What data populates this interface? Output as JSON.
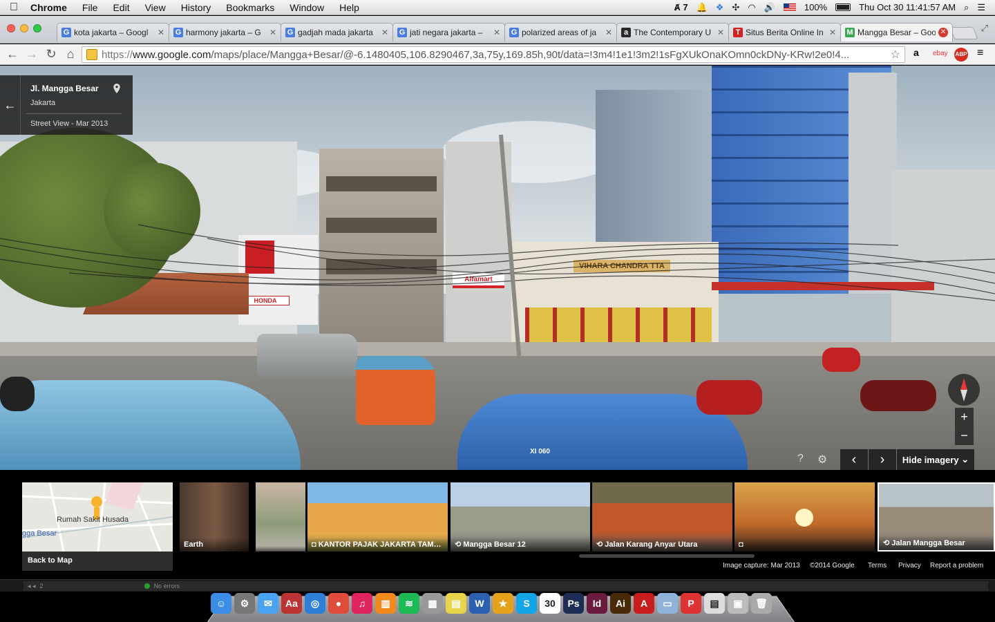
{
  "menubar": {
    "app": "Chrome",
    "items": [
      "File",
      "Edit",
      "View",
      "History",
      "Bookmarks",
      "Window",
      "Help"
    ],
    "adobe_badge": "7",
    "battery": "100%",
    "datetime": "Thu Oct 30  11:41:57 AM"
  },
  "tabs": [
    {
      "title": "kota jakarta – Googl",
      "favicon": "G",
      "color": "#4a7de2"
    },
    {
      "title": "harmony jakarta – G",
      "favicon": "G",
      "color": "#4a7de2"
    },
    {
      "title": "gadjah mada jakarta",
      "favicon": "G",
      "color": "#4a7de2"
    },
    {
      "title": "jati negara jakarta –",
      "favicon": "G",
      "color": "#4a7de2"
    },
    {
      "title": "polarized areas of ja",
      "favicon": "G",
      "color": "#4a7de2"
    },
    {
      "title": "The Contemporary U",
      "favicon": "a",
      "color": "#2a2a2a"
    },
    {
      "title": "Situs Berita Online In",
      "favicon": "T",
      "color": "#d42020"
    },
    {
      "title": "Mangga Besar – Goo",
      "favicon": "M",
      "color": "#3aa757"
    }
  ],
  "toolbar": {
    "url_prefix": "https://",
    "url_host": "www.google.com",
    "url_path": "/maps/place/Mangga+Besar/@-6.1480405,106.8290467,3a,75y,169.85h,90t/data=!3m4!1e1!3m2!1sFgXUkOnaKOmn0ckDNy-KRw!2e0!4..."
  },
  "info_card": {
    "place": "Jl. Mangga Besar",
    "city": "Jakarta",
    "date": "Street View - Mar 2013"
  },
  "controls": {
    "hide_imagery": "Hide imagery",
    "zoom_in": "+",
    "zoom_out": "−",
    "help": "?",
    "settings": "⚙",
    "prev": "‹",
    "next": "›"
  },
  "scene_signs": {
    "vihara": "VIHARA CHANDRA TTA",
    "honda": "HONDA",
    "alfamart": "Alfamart",
    "taxi_plate": "XI 060"
  },
  "filmstrip": {
    "map_label_1": "Rumah Sakit Husada",
    "map_label_2": "gga Besar",
    "back_to_map": "Back to Map",
    "thumbs": [
      {
        "caption": "Earth"
      },
      {
        "caption": ""
      },
      {
        "caption": "KANTOR PAJAK JAKARTA TAM…"
      },
      {
        "caption": "Mangga Besar 12"
      },
      {
        "caption": "Jalan Karang Anyar Utara"
      },
      {
        "caption": ""
      },
      {
        "caption": "Jalan Mangga Besar"
      }
    ],
    "footer": {
      "capture": "Image capture: Mar 2013",
      "copyright": "©2014 Google",
      "terms": "Terms",
      "privacy": "Privacy",
      "report": "Report a problem"
    }
  },
  "devbar": {
    "page": "2",
    "status": "No errors"
  },
  "dock": {
    "icons": [
      {
        "name": "finder",
        "glyph": "☺",
        "color": "#3a8ee6"
      },
      {
        "name": "system-prefs",
        "glyph": "⚙",
        "color": "#777"
      },
      {
        "name": "messages",
        "glyph": "✉",
        "color": "#4aa3f0"
      },
      {
        "name": "dictionary",
        "glyph": "Aa",
        "color": "#b33"
      },
      {
        "name": "safari",
        "glyph": "◎",
        "color": "#2d7fd8"
      },
      {
        "name": "chrome",
        "glyph": "●",
        "color": "#e04c3a"
      },
      {
        "name": "itunes",
        "glyph": "♫",
        "color": "#e0245e"
      },
      {
        "name": "ibooks",
        "glyph": "▥",
        "color": "#f08a1c"
      },
      {
        "name": "spotify",
        "glyph": "≋",
        "color": "#1db954"
      },
      {
        "name": "calculator",
        "glyph": "▦",
        "color": "#999"
      },
      {
        "name": "stickies",
        "glyph": "▤",
        "color": "#e8d44a"
      },
      {
        "name": "word",
        "glyph": "W",
        "color": "#2b5fb0"
      },
      {
        "name": "wunderlist",
        "glyph": "★",
        "color": "#e3a21a"
      },
      {
        "name": "skype",
        "glyph": "S",
        "color": "#12a5e8"
      },
      {
        "name": "calendar",
        "glyph": "30",
        "color": "#fff"
      },
      {
        "name": "photoshop",
        "glyph": "Ps",
        "color": "#1d2d55"
      },
      {
        "name": "indesign",
        "glyph": "Id",
        "color": "#6b1b3d"
      },
      {
        "name": "illustrator",
        "glyph": "Ai",
        "color": "#4a2a06"
      },
      {
        "name": "acrobat",
        "glyph": "A",
        "color": "#c81d1d"
      },
      {
        "name": "folder",
        "glyph": "▭",
        "color": "#8fb3d8"
      },
      {
        "name": "pdf-doc",
        "glyph": "P",
        "color": "#d33"
      },
      {
        "name": "documents-stack",
        "glyph": "▤",
        "color": "#ddd"
      },
      {
        "name": "downloads-stack",
        "glyph": "▣",
        "color": "#bbb"
      },
      {
        "name": "trash",
        "glyph": "🗑",
        "color": "#aaa"
      }
    ]
  }
}
